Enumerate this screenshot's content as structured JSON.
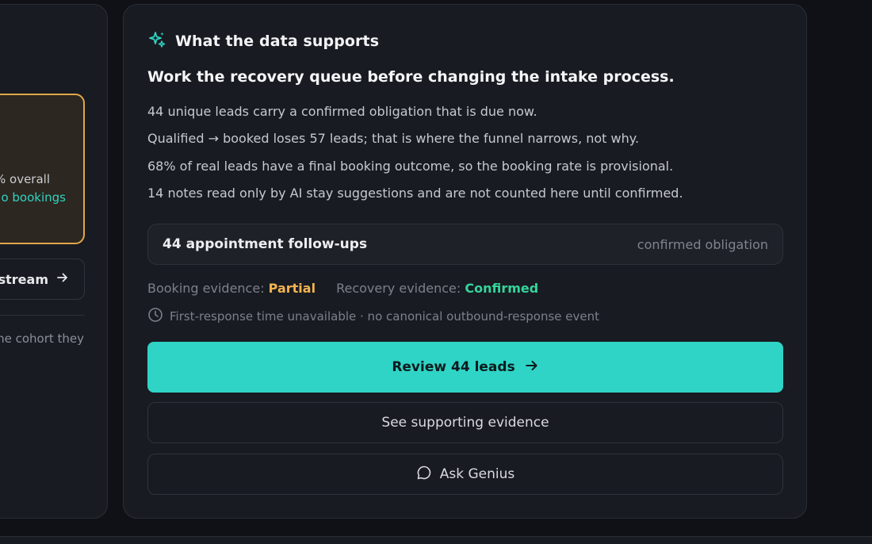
{
  "left_panel": {
    "metric_line1": "% overall",
    "metric_line2": "o bookings",
    "stream_label": "stream",
    "note": "ne cohort they"
  },
  "card": {
    "title": "What the data supports",
    "headline": "Work the recovery queue before changing the intake process.",
    "findings": [
      "44 unique leads carry a confirmed obligation that is due now.",
      "Qualified → booked loses 57 leads; that is where the funnel narrows, not why.",
      "68% of real leads have a final booking outcome, so the booking rate is provisional.",
      "14 notes read only by AI stay suggestions and are not counted here until confirmed."
    ],
    "obligation": {
      "title": "44 appointment follow-ups",
      "tag": "confirmed obligation"
    },
    "evidence": {
      "booking_label": "Booking evidence:",
      "booking_value": "Partial",
      "recovery_label": "Recovery evidence:",
      "recovery_value": "Confirmed"
    },
    "response_note": "First-response time unavailable · no canonical outbound-response event",
    "buttons": {
      "primary": "Review 44 leads",
      "evidence": "See supporting evidence",
      "genius": "Ask Genius"
    }
  },
  "colors": {
    "accent": "#2fd4c6",
    "partial": "#f2b350",
    "confirmed": "#34d59a",
    "card_bg": "#191b22",
    "page_bg": "#0f1116"
  },
  "icons": {
    "header": "sparkle-icon",
    "clock": "clock-icon",
    "arrow": "arrow-right-icon",
    "chat": "chat-bubble-icon"
  }
}
